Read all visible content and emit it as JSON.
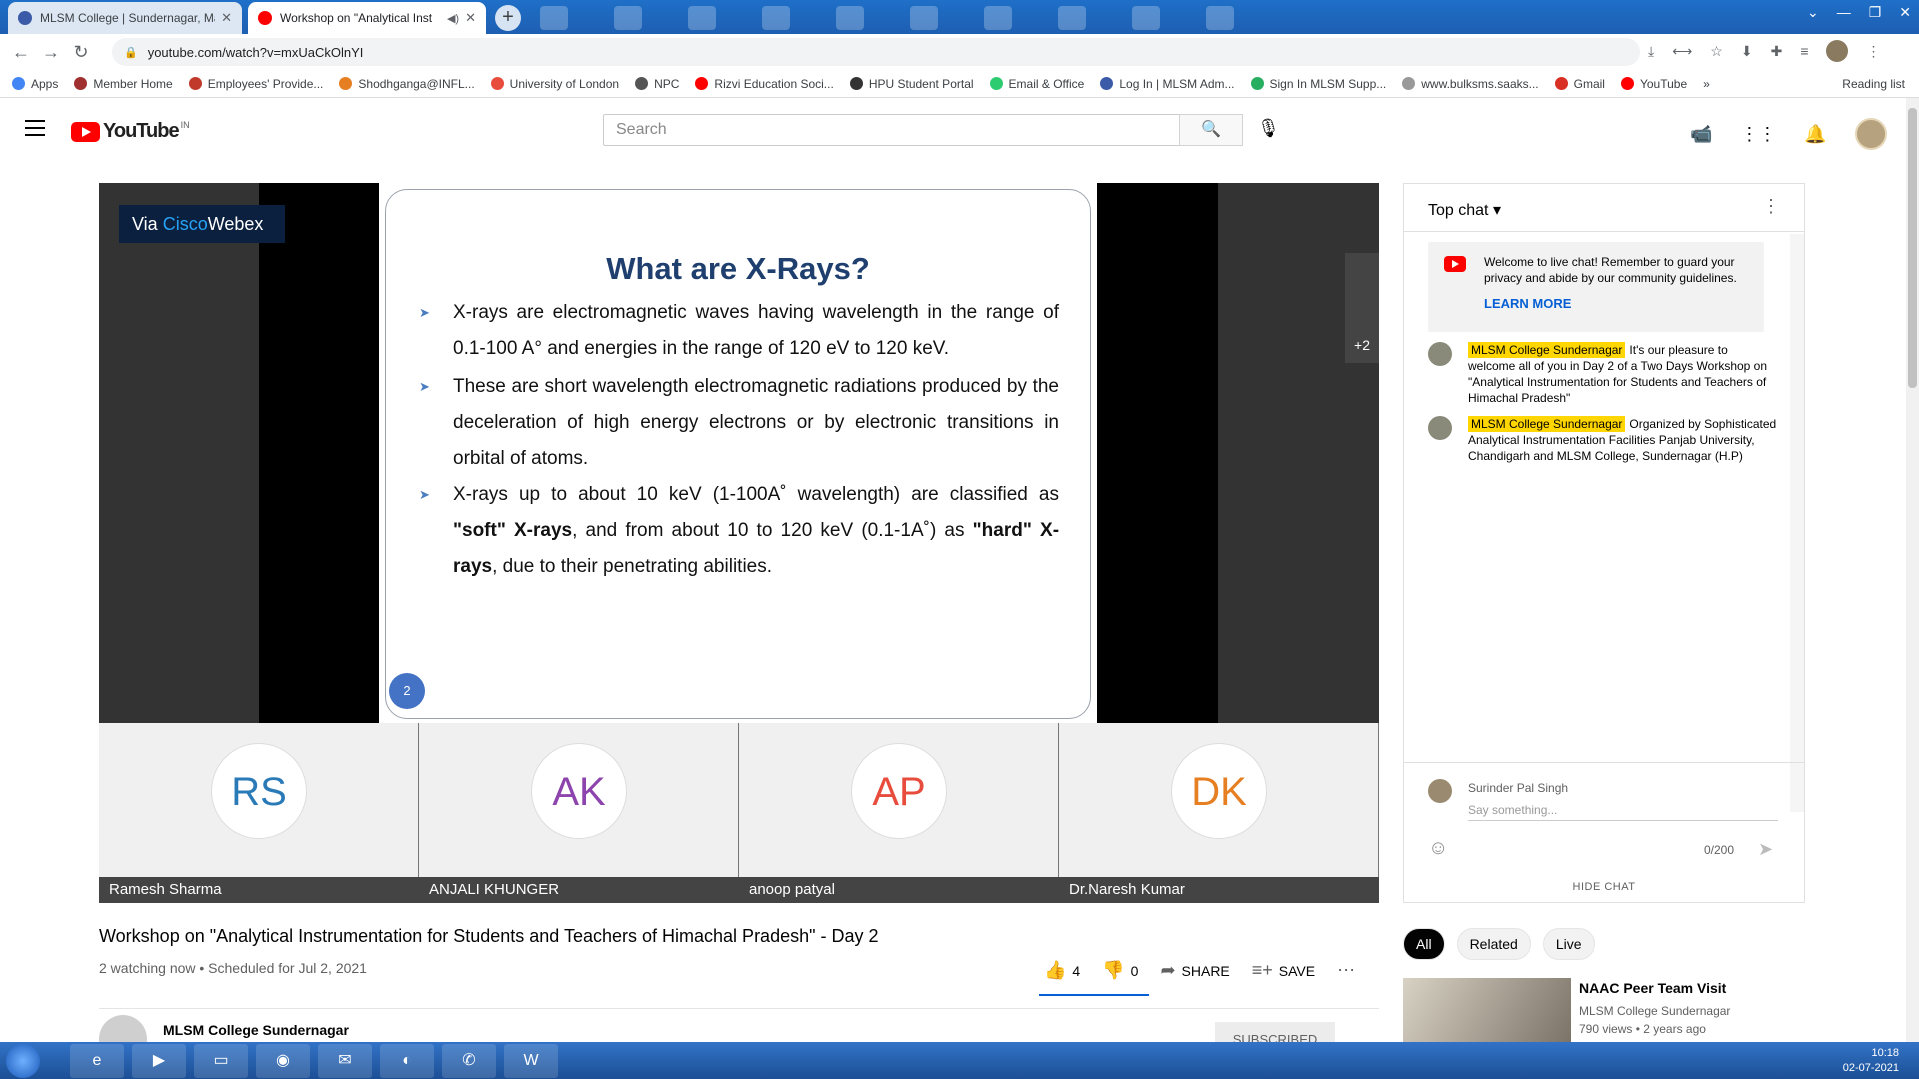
{
  "browser": {
    "tabs": [
      {
        "title": "MLSM College | Sundernagar, Ma",
        "color": "#3b5ba9"
      },
      {
        "title": "Workshop on \"Analytical Inst",
        "color": "#ff0000"
      }
    ],
    "new_tab": "+",
    "url": "youtube.com/watch?v=mxUaCkOlnYI",
    "bookmarks": [
      {
        "label": "Apps",
        "color": "#4285f4"
      },
      {
        "label": "Member Home",
        "color": "#a03030"
      },
      {
        "label": "Employees' Provide...",
        "color": "#c0392b"
      },
      {
        "label": "Shodhganga@INFL...",
        "color": "#e67e22"
      },
      {
        "label": "University of London",
        "color": "#e74c3c"
      },
      {
        "label": "NPC",
        "color": "#555555"
      },
      {
        "label": "Rizvi Education Soci...",
        "color": "#ff0000"
      },
      {
        "label": "HPU Student Portal",
        "color": "#333333"
      },
      {
        "label": "Email & Office",
        "color": "#2ecc71"
      },
      {
        "label": "Log In | MLSM Adm...",
        "color": "#3b5ba9"
      },
      {
        "label": "Sign In MLSM Supp...",
        "color": "#27ae60"
      },
      {
        "label": "www.bulksms.saaks...",
        "color": "#999999"
      },
      {
        "label": "Gmail",
        "color": "#d93025"
      },
      {
        "label": "YouTube",
        "color": "#ff0000"
      }
    ],
    "bookmarks_more": "»",
    "reading_list": "Reading list"
  },
  "youtube": {
    "logo_text": "YouTube",
    "country": "IN",
    "search_placeholder": "Search"
  },
  "player": {
    "webex_prefix": "Via ",
    "webex_brand": "Cisco",
    "webex_suffix": "Webex",
    "slide": {
      "title": "What are X-Rays?",
      "bullet1": "X-rays are electromagnetic waves having wavelength in the range of 0.1-100 A° and energies in the range of 120 eV to 120 keV.",
      "bullet2": "These are short wavelength electromagnetic radiations produced by the deceleration of high energy electrons or by electronic transitions in orbital of atoms.",
      "bullet3_a": "X-rays up to about 10 keV (1-100A˚ wavelength) are classified as ",
      "bullet3_b": "\"soft\" X-rays",
      "bullet3_c": ", and from about 10 to 120 keV (0.1-1A˚) as ",
      "bullet3_d": "\"hard\" X-rays",
      "bullet3_e": ", due to their penetrating abilities.",
      "page_number": "2"
    },
    "participants": [
      {
        "initials": "RS",
        "name": "Ramesh Sharma",
        "color": "#2a7ab8"
      },
      {
        "initials": "AK",
        "name": "ANJALI KHUNGER",
        "color": "#8e44ad"
      },
      {
        "initials": "AP",
        "name": "anoop patyal",
        "color": "#e74c3c"
      },
      {
        "initials": "DK",
        "name": "Dr.Naresh Kumar",
        "color": "#e67e22"
      }
    ],
    "more_participants": "+2"
  },
  "video": {
    "title": "Workshop on \"Analytical Instrumentation for Students and Teachers of Himachal Pradesh\" - Day 2",
    "meta": "2 watching now • Scheduled for Jul 2, 2021",
    "likes": "4",
    "dislikes": "0",
    "share": "SHARE",
    "save": "SAVE",
    "channel": "MLSM College Sundernagar",
    "subscribed": "SUBSCRIBED"
  },
  "chat": {
    "mode": "Top chat",
    "welcome": "Welcome to live chat! Remember to guard your privacy and abide by our community guidelines.",
    "learn_more": "LEARN MORE",
    "messages": [
      {
        "author": "MLSM College Sundernagar",
        "text": "It's our pleasure to welcome all of you in Day 2 of a Two Days Workshop on \"Analytical Instrumentation for Students and Teachers of Himachal Pradesh\""
      },
      {
        "author": "MLSM College Sundernagar",
        "text": "Organized by Sophisticated Analytical Instrumentation Facilities Panjab University, Chandigarh and MLSM College, Sundernagar (H.P)"
      }
    ],
    "user_name": "Surinder Pal Singh",
    "input_placeholder": "Say something...",
    "counter": "0/200",
    "hide_chat": "HIDE CHAT"
  },
  "chips": [
    "All",
    "Related",
    "Live"
  ],
  "recommendation": {
    "title": "NAAC Peer Team Visit",
    "channel": "MLSM College Sundernagar",
    "meta": "790 views • 2 years ago"
  },
  "taskbar": {
    "time": "10:18",
    "date": "02-07-2021"
  }
}
